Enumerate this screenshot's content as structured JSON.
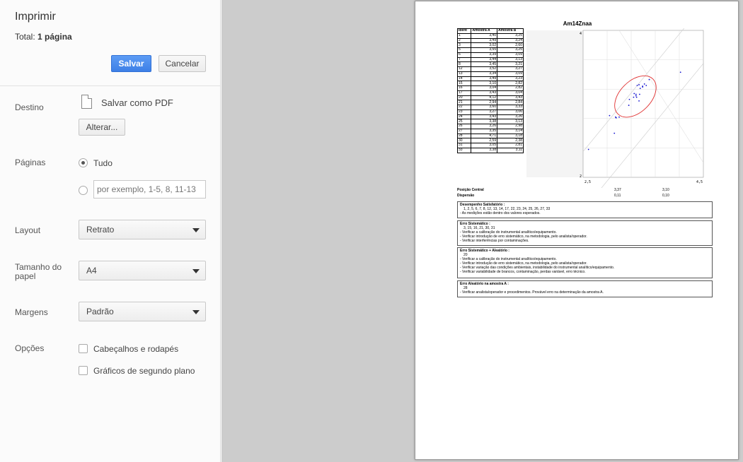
{
  "sidebar": {
    "title": "Imprimir",
    "total_label": "Total: ",
    "total_value": "1 página",
    "save_label": "Salvar",
    "cancel_label": "Cancelar",
    "destination": {
      "label": "Destino",
      "value": "Salvar como PDF",
      "change_label": "Alterar..."
    },
    "pages": {
      "label": "Páginas",
      "all_label": "Tudo",
      "custom_placeholder": "por exemplo, 1-5, 8, 11-13"
    },
    "layout": {
      "label": "Layout",
      "value": "Retrato"
    },
    "paper_size": {
      "label_line1": "Tamanho do",
      "label_line2": "papel",
      "value": "A4"
    },
    "margins": {
      "label": "Margens",
      "value": "Padrão"
    },
    "options": {
      "label": "Opções",
      "headers_footers": "Cabeçalhos e rodapés",
      "background_graphics": "Gráficos de segundo plano"
    }
  },
  "preview": {
    "doc_title": "Am14Znaa",
    "table": {
      "headers": [
        "Ident",
        "Amostra A",
        "Amostra B"
      ],
      "rows": [
        [
          "1",
          "3,40",
          "3,25"
        ],
        [
          "2",
          "3,49",
          "3,24"
        ],
        [
          "3",
          "3,02",
          "2,60"
        ],
        [
          "5",
          "3,55",
          "3,25"
        ],
        [
          "6",
          "3,39",
          "3,09"
        ],
        [
          "7",
          "3,44",
          "3,13"
        ],
        [
          "8",
          "3,45",
          "3,21"
        ],
        [
          "12",
          "3,52",
          "3,27"
        ],
        [
          "13",
          "3,34",
          "3,09"
        ],
        [
          "14",
          "3,49",
          "3,23"
        ],
        [
          "15",
          "3,10",
          "2,82"
        ],
        [
          "16",
          "3,04",
          "2,82"
        ],
        [
          "17",
          "3,43",
          "3,04"
        ],
        [
          "20",
          "4,12",
          "3,43"
        ],
        [
          "21",
          "2,94",
          "2,84"
        ],
        [
          "22",
          "3,60",
          "3,33"
        ],
        [
          "23",
          "3,27",
          "3,06"
        ],
        [
          "24",
          "3,43",
          "3,26"
        ],
        [
          "25",
          "3,38",
          "3,13"
        ],
        [
          "26",
          "3,26",
          "2,98"
        ],
        [
          "27",
          "3,35",
          "3,14"
        ],
        [
          "28",
          "4,71",
          "3,18"
        ],
        [
          "30",
          "2,59",
          "2,38"
        ],
        [
          "31",
          "3,05",
          "2,81"
        ],
        [
          "33",
          "3,38",
          "3,11"
        ]
      ]
    },
    "chart_data": {
      "type": "scatter",
      "title": "",
      "xlim": [
        2.5,
        4.5
      ],
      "ylim": [
        2,
        4
      ],
      "x_tick_labels": [
        "2,5",
        "4,5"
      ],
      "y_tick_labels": [
        "2",
        "4"
      ],
      "series": [
        {
          "x": [
            3.4,
            3.49,
            3.02,
            3.55,
            3.39,
            3.44,
            3.45,
            3.52,
            3.34,
            3.49,
            3.1,
            3.04,
            3.43,
            4.12,
            2.94,
            3.6,
            3.27,
            3.43,
            3.38,
            3.26,
            3.35,
            4.71,
            2.59,
            3.05,
            3.38
          ],
          "y": [
            3.25,
            3.24,
            2.6,
            3.25,
            3.09,
            3.13,
            3.21,
            3.27,
            3.09,
            3.23,
            2.82,
            2.82,
            3.04,
            3.43,
            2.84,
            3.33,
            3.06,
            3.26,
            3.13,
            2.98,
            3.14,
            3.18,
            2.38,
            2.81,
            3.11
          ]
        }
      ],
      "ellipse": {
        "center": [
          3.37,
          3.1
        ],
        "color": "#e03030"
      },
      "point_color": "#1010d0",
      "grid": true
    },
    "summary": {
      "position_label": "Posição Central",
      "position_a": "3,37",
      "position_b": "3,10",
      "dispersion_label": "Dispersão",
      "dispersion_a": "0,11",
      "dispersion_b": "0,10"
    },
    "boxes": [
      {
        "title": "Desempenho Satisfatório :",
        "ids": "1, 2, 5, 6, 7, 8, 12, 13, 14, 17, 22, 23, 24, 25, 26, 27, 33",
        "notes": [
          "- As medições estão dentro dos valores esperados."
        ]
      },
      {
        "title": "Erro Sistemático :",
        "ids": "3, 15, 16, 21, 30, 31",
        "notes": [
          "- Verificar a calibração do instrumental analítico/equipamento.",
          "- Verificar introdução de erro sistemático, na metodologia, pelo analista/operador.",
          "- Verificar interferências por contaminações."
        ]
      },
      {
        "title": "Erro Sistemático + Aleatório :",
        "ids": "20",
        "notes": [
          "- Verificar a calibração do instrumental analítico/equipamento.",
          "- Verificar introdução de erro sistemático, na metodologia, pelo analista/operador.",
          "- Verificar variação das condições ambientais, instabilidade do instrumental analítico/equipamento.",
          "- Verificar variabilidade de brancos, contaminação, perdas variável, erro técnico."
        ]
      },
      {
        "title": "Erro Aleatório na amostra A :",
        "ids": "28",
        "notes": [
          "- Verificar analista/operador e procedimentos. Provável erro na determinação da amostra A."
        ]
      }
    ]
  }
}
